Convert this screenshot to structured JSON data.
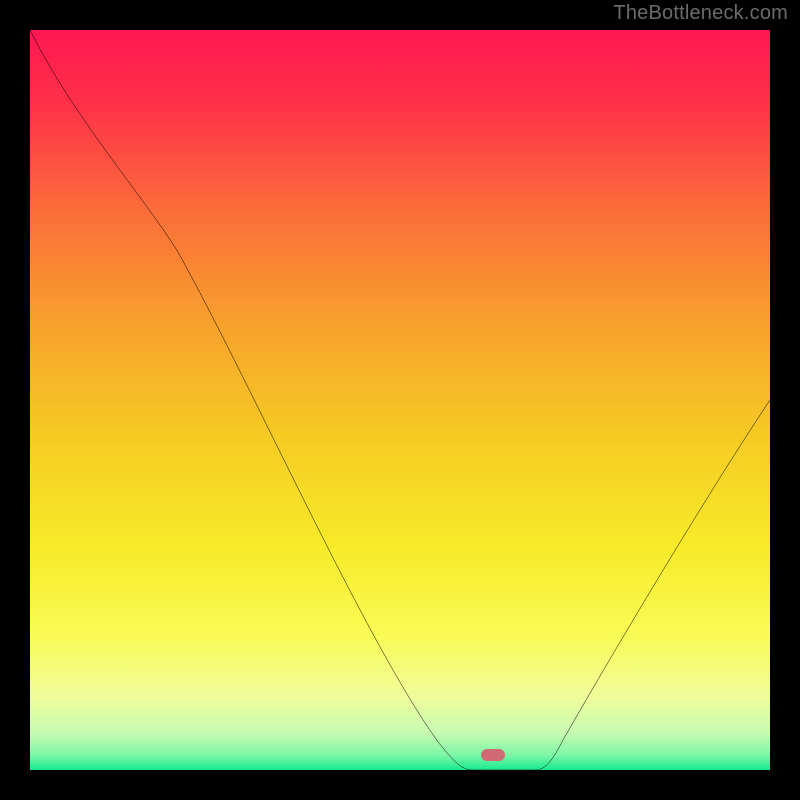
{
  "watermark": "TheBottleneck.com",
  "chart_data": {
    "type": "line",
    "title": "",
    "xlabel": "",
    "ylabel": "",
    "xlim": [
      0,
      100
    ],
    "ylim": [
      0,
      100
    ],
    "x": [
      0,
      5,
      10,
      15,
      20,
      25,
      30,
      35,
      40,
      45,
      50,
      55,
      60,
      62,
      64,
      66,
      68,
      72,
      76,
      80,
      85,
      90,
      95,
      100
    ],
    "y": [
      100,
      92,
      84,
      76,
      70,
      62,
      55,
      47,
      38,
      28,
      18,
      8,
      1,
      0,
      0,
      0,
      0,
      4,
      10,
      18,
      27,
      35,
      43,
      50
    ],
    "marker": {
      "x": 64,
      "y": 0,
      "color": "#cf6a72"
    },
    "background_gradient": {
      "orientation": "vertical",
      "stops": [
        {
          "pos": 0.0,
          "color": "#ff1752"
        },
        {
          "pos": 0.1,
          "color": "#ff3148"
        },
        {
          "pos": 0.25,
          "color": "#fb6f39"
        },
        {
          "pos": 0.4,
          "color": "#f7a22c"
        },
        {
          "pos": 0.55,
          "color": "#f6cb23"
        },
        {
          "pos": 0.7,
          "color": "#f7eb29"
        },
        {
          "pos": 0.82,
          "color": "#f9fb56"
        },
        {
          "pos": 0.9,
          "color": "#f0fc9a"
        },
        {
          "pos": 0.95,
          "color": "#c6fbb1"
        },
        {
          "pos": 0.98,
          "color": "#7df6a7"
        },
        {
          "pos": 1.0,
          "color": "#15eb8f"
        }
      ]
    },
    "notes": "V-shaped bottleneck curve over a red→green vertical heat gradient; curve minimum (optimal point) marked near x≈64. Axes unlabeled; values estimated from pixel positions on a 0–100 normalized grid."
  }
}
